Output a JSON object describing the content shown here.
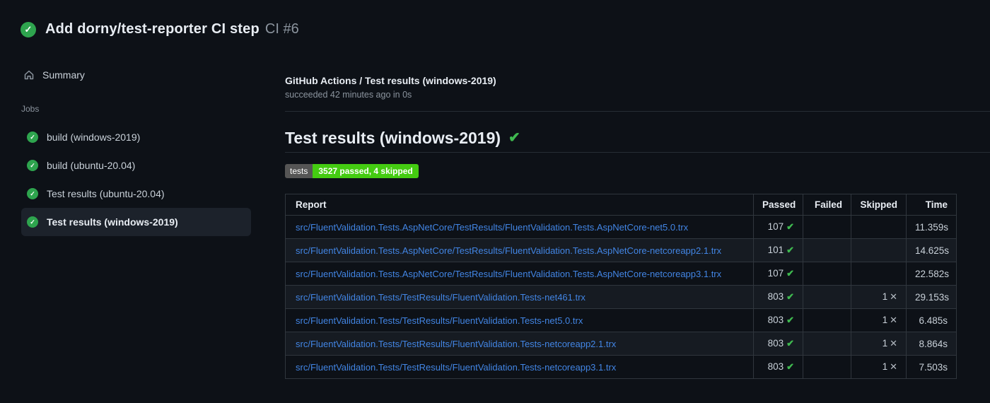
{
  "app": {
    "title": "Add dorny/test-reporter CI step",
    "run_number": "CI #6",
    "status_icon": "✓"
  },
  "sidebar": {
    "summary_label": "Summary",
    "jobs_heading": "Jobs",
    "jobs": [
      {
        "label": "build (windows-2019)",
        "selected": false
      },
      {
        "label": "build (ubuntu-20.04)",
        "selected": false
      },
      {
        "label": "Test results (ubuntu-20.04)",
        "selected": false
      },
      {
        "label": "Test results (windows-2019)",
        "selected": true
      }
    ]
  },
  "check_header": {
    "title": "GitHub Actions / Test results (windows-2019)",
    "status": "succeeded 42 minutes ago in 0s"
  },
  "section": {
    "title": "Test results (windows-2019)",
    "status_icon": "✔"
  },
  "badge": {
    "label": "tests",
    "value": "3527 passed, 4 skipped",
    "label_bg": "#555555",
    "value_bg": "#44cc11"
  },
  "table": {
    "columns": [
      "Report",
      "Passed",
      "Failed",
      "Skipped",
      "Time"
    ],
    "pass_icon": "✔",
    "skip_icon": "✕",
    "rows": [
      {
        "report": "src/FluentValidation.Tests.AspNetCore/TestResults/FluentValidation.Tests.AspNetCore-net5.0.trx",
        "passed": "107",
        "failed": "",
        "skipped": "",
        "time": "11.359s"
      },
      {
        "report": "src/FluentValidation.Tests.AspNetCore/TestResults/FluentValidation.Tests.AspNetCore-netcoreapp2.1.trx",
        "passed": "101",
        "failed": "",
        "skipped": "",
        "time": "14.625s"
      },
      {
        "report": "src/FluentValidation.Tests.AspNetCore/TestResults/FluentValidation.Tests.AspNetCore-netcoreapp3.1.trx",
        "passed": "107",
        "failed": "",
        "skipped": "",
        "time": "22.582s"
      },
      {
        "report": "src/FluentValidation.Tests/TestResults/FluentValidation.Tests-net461.trx",
        "passed": "803",
        "failed": "",
        "skipped": "1",
        "time": "29.153s"
      },
      {
        "report": "src/FluentValidation.Tests/TestResults/FluentValidation.Tests-net5.0.trx",
        "passed": "803",
        "failed": "",
        "skipped": "1",
        "time": "6.485s"
      },
      {
        "report": "src/FluentValidation.Tests/TestResults/FluentValidation.Tests-netcoreapp2.1.trx",
        "passed": "803",
        "failed": "",
        "skipped": "1",
        "time": "8.864s"
      },
      {
        "report": "src/FluentValidation.Tests/TestResults/FluentValidation.Tests-netcoreapp3.1.trx",
        "passed": "803",
        "failed": "",
        "skipped": "1",
        "time": "7.503s"
      }
    ]
  },
  "colors": {
    "page_bg": "#0d1117",
    "row_alt_bg": "#161b22",
    "table_border": "#30363d",
    "link": "#4285e4",
    "success_green": "#2ea44e",
    "check_green": "#3fb950",
    "selected_item_bg": "#1c222b"
  }
}
